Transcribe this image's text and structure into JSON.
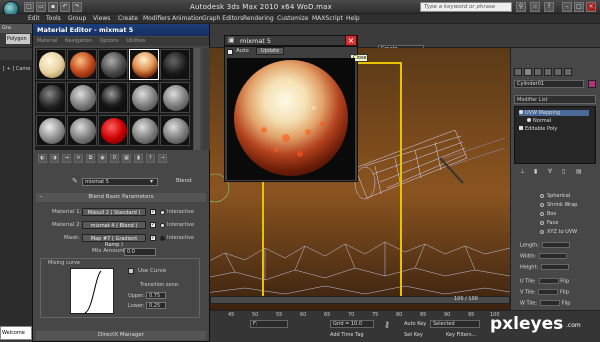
{
  "app": {
    "title": "Autodesk 3ds Max  2010 x64      WoD.max",
    "search_placeholder": "Type a keyword or phrase"
  },
  "menu": [
    "Edit",
    "Tools",
    "Group",
    "Views",
    "Create",
    "Modifiers",
    "Animation",
    "Graph Editors",
    "Rendering",
    "Customize",
    "MAXScript",
    "Help"
  ],
  "ribbon": {
    "tab": "Gra",
    "polygon_tab": "Polygon",
    "create_selection": "Create Selection Se"
  },
  "left_viewport": {
    "label": "[ + ] Came",
    "listener": "Welcome"
  },
  "material_editor": {
    "title": "Material Editor - mixmat 5",
    "menu": [
      "Material",
      "Navigation",
      "Options",
      "Utilities"
    ],
    "material_name": "mixmat 5",
    "type_button": "Blend",
    "rollout_title": "Blend Basic Parameters",
    "material1_label": "Material 1:",
    "material1_value": "Mdoull 2 ( Standard )",
    "material2_label": "Material 2:",
    "material2_value": "mixmat 4 ( Blend )",
    "mask_label": "Mask:",
    "mask_value": "Map #7 ( Gradient Ramp )",
    "interactive": "Interactive",
    "mix_amount_label": "Mix Amount:",
    "mix_amount_value": "0.0",
    "mixing_curve_label": "Mixing curve",
    "use_curve_label": "Use Curve",
    "transition_zone_label": "Transition zone:",
    "upper_label": "Upper:",
    "upper_value": "0.75",
    "lower_label": "Lower:",
    "lower_value": "0.25",
    "directx_label": "DirectX Manager",
    "rollout_minus": "-"
  },
  "mixmat_window": {
    "title": "mixmat 5",
    "auto_label": "Auto",
    "update_label": "Update",
    "close_tooltip": "Close"
  },
  "command_panel": {
    "object_name": "Cylinder01",
    "modifier_list": "Modifier List",
    "stack": [
      "UVW Mapping",
      "Normal",
      "Editable Poly"
    ],
    "mapping_options": [
      "Spherical",
      "Shrink Wrap",
      "Box",
      "Face",
      "XYZ to UVW"
    ],
    "length_label": "Length:",
    "width_label": "Width:",
    "height_label": "Height:",
    "u_tile": "U Tile:",
    "v_tile": "V Tile:",
    "w_tile": "W Tile:",
    "flip": "Flip"
  },
  "timeline": {
    "frame": "100 / 100",
    "ticks": [
      "45",
      "50",
      "55",
      "60",
      "65",
      "70",
      "75",
      "80",
      "85",
      "90",
      "95",
      "100"
    ],
    "field_f": "F:",
    "grid": "Grid = 10.0",
    "auto_key": "Auto Key",
    "selected": "Selected",
    "set_key": "Set Key",
    "add_time_tag": "Add Time Tag",
    "key_filters": "Key Filters..."
  },
  "watermark": {
    "text": "pxleyes",
    "suffix": ".com"
  },
  "colors": {
    "title_bar": "#1c3e7a",
    "close_red": "#cc3333",
    "viewport_frame": "#e8c400",
    "object_swatch": "#b0347a"
  }
}
